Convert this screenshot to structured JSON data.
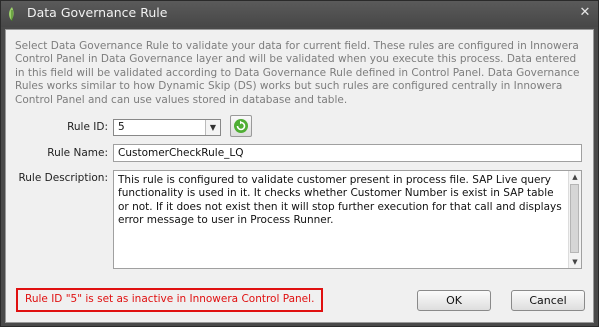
{
  "window": {
    "title": "Data Governance Rule",
    "close_glyph": "✕",
    "app_icon": "leaf-icon"
  },
  "info_text": "Select Data Governance Rule to validate your data for current field. These rules are configured in Innowera Control Panel in Data Governance layer and will be validated when you execute this process. Data entered in this field will be validated according to Data Governance Rule defined in Control Panel. Data Governance Rules works similar to how Dynamic Skip (DS) works but such rules are configured centrally in Innowera Control Panel and can use values stored in database and table.",
  "form": {
    "rule_id_label": "Rule ID:",
    "rule_id_value": "5",
    "rule_name_label": "Rule Name:",
    "rule_name_value": "CustomerCheckRule_LQ",
    "rule_description_label": "Rule Description:",
    "rule_description_value": "This rule is configured to validate customer present in process file. SAP Live query functionality is used in it.  It checks whether Customer Number is exist in SAP table or not. If it does not exist then it will stop further execution for that call and displays error message to user in Process Runner."
  },
  "status": {
    "error_message": "Rule ID \"5\" is set as inactive in Innowera Control Panel.",
    "error_color": "#e01010"
  },
  "buttons": {
    "ok_label": "OK",
    "cancel_label": "Cancel"
  },
  "icons": {
    "refresh": "refresh-icon",
    "dropdown": "chevron-down-icon"
  }
}
